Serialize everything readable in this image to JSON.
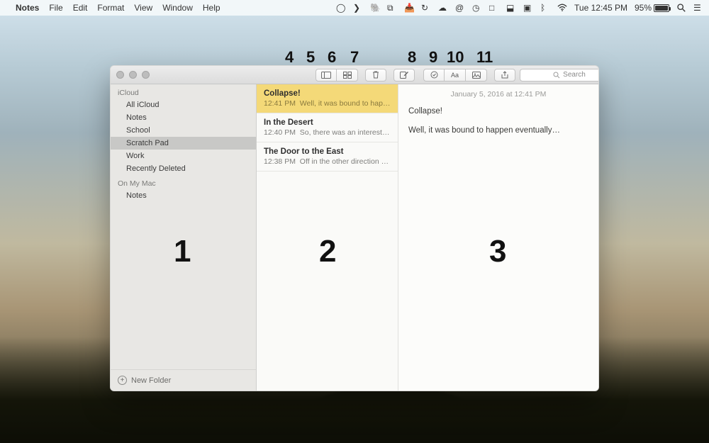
{
  "menubar": {
    "app": "Notes",
    "items": [
      "File",
      "Edit",
      "Format",
      "View",
      "Window",
      "Help"
    ],
    "clock": "Tue 12:45 PM",
    "battery": "95%"
  },
  "overlay": {
    "big": [
      "1",
      "2",
      "3"
    ],
    "small": [
      "4",
      "5",
      "6",
      "7",
      "8",
      "9",
      "10",
      "11"
    ]
  },
  "toolbar": {
    "search_placeholder": "Search"
  },
  "sidebar": {
    "sections": [
      {
        "label": "iCloud",
        "items": [
          "All iCloud",
          "Notes",
          "School",
          "Scratch Pad",
          "Work",
          "Recently Deleted"
        ],
        "selected_index": 3
      },
      {
        "label": "On My Mac",
        "items": [
          "Notes"
        ],
        "selected_index": -1
      }
    ],
    "new_folder_label": "New Folder"
  },
  "note_list": {
    "selected_index": 0,
    "items": [
      {
        "title": "Collapse!",
        "time": "12:41 PM",
        "preview": "Well, it was bound to happen event…"
      },
      {
        "title": "In the Desert",
        "time": "12:40 PM",
        "preview": "So, there was an interesting time w…"
      },
      {
        "title": "The Door to the East",
        "time": "12:38 PM",
        "preview": "Off in the other direction there wa…"
      }
    ]
  },
  "editor": {
    "date": "January 5, 2016 at 12:41 PM",
    "title": "Collapse!",
    "body": "Well, it was bound to happen eventually…"
  }
}
